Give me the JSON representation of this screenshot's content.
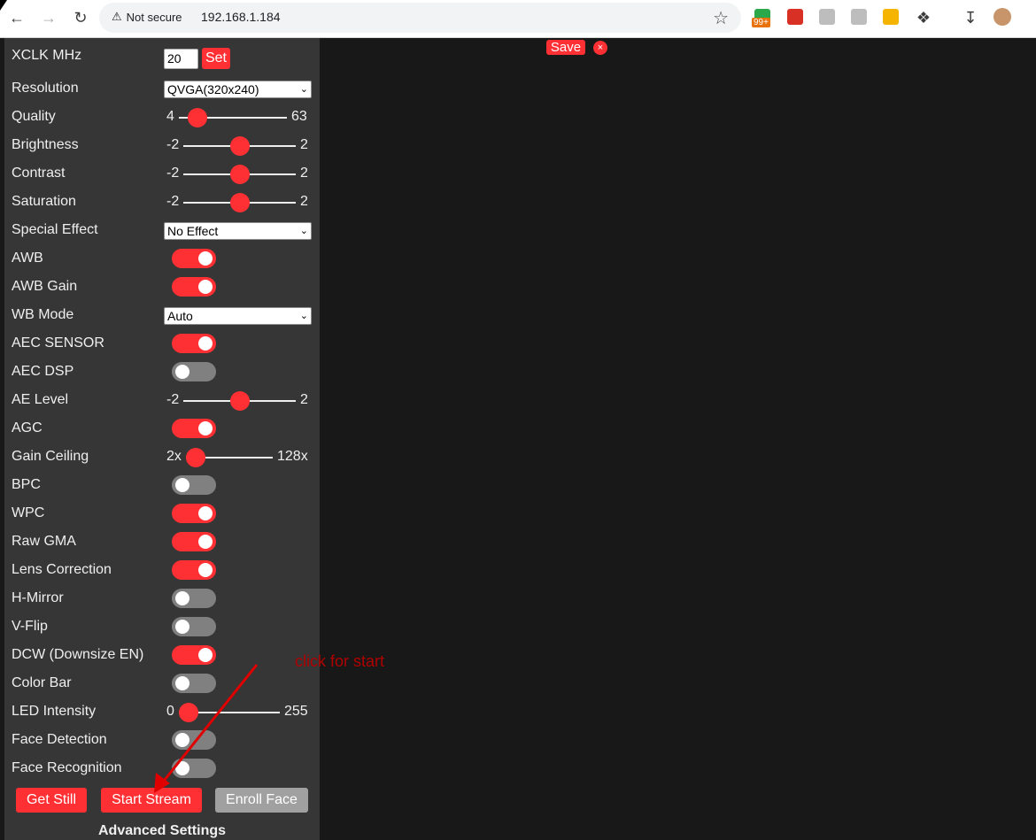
{
  "browser": {
    "security_text": "Not secure",
    "url": "192.168.1.184",
    "badge": "99+"
  },
  "controls": {
    "xclk_label": "XCLK MHz",
    "xclk_value": "20",
    "set_label": "Set",
    "resolution_label": "Resolution",
    "resolution_value": "QVGA(320x240)",
    "quality": {
      "label": "Quality",
      "min": "4",
      "max": "63",
      "value": 10
    },
    "brightness": {
      "label": "Brightness",
      "min": "-2",
      "max": "2",
      "value": 0
    },
    "contrast": {
      "label": "Contrast",
      "min": "-2",
      "max": "2",
      "value": 0
    },
    "saturation": {
      "label": "Saturation",
      "min": "-2",
      "max": "2",
      "value": 0
    },
    "special_effect_label": "Special Effect",
    "special_effect_value": "No Effect",
    "awb": {
      "label": "AWB",
      "on": true
    },
    "awb_gain": {
      "label": "AWB Gain",
      "on": true
    },
    "wb_mode_label": "WB Mode",
    "wb_mode_value": "Auto",
    "aec_sensor": {
      "label": "AEC SENSOR",
      "on": true
    },
    "aec_dsp": {
      "label": "AEC DSP",
      "on": false
    },
    "ae_level": {
      "label": "AE Level",
      "min": "-2",
      "max": "2",
      "value": 0
    },
    "agc": {
      "label": "AGC",
      "on": true
    },
    "gain_ceiling": {
      "label": "Gain Ceiling",
      "min": "2x",
      "max": "128x",
      "value": 0
    },
    "bpc": {
      "label": "BPC",
      "on": false
    },
    "wpc": {
      "label": "WPC",
      "on": true
    },
    "raw_gma": {
      "label": "Raw GMA",
      "on": true
    },
    "lens_correction": {
      "label": "Lens Correction",
      "on": true
    },
    "hmirror": {
      "label": "H-Mirror",
      "on": false
    },
    "vflip": {
      "label": "V-Flip",
      "on": false
    },
    "dcw": {
      "label": "DCW (Downsize EN)",
      "on": true
    },
    "color_bar": {
      "label": "Color Bar",
      "on": false
    },
    "led_intensity": {
      "label": "LED Intensity",
      "min": "0",
      "max": "255",
      "value": 0
    },
    "face_detection": {
      "label": "Face Detection",
      "on": false
    },
    "face_recognition": {
      "label": "Face Recognition",
      "on": false
    }
  },
  "buttons": {
    "get_still": "Get Still",
    "start_stream": "Start Stream",
    "enroll_face": "Enroll Face"
  },
  "advanced_settings": "Advanced Settings",
  "save_label": "Save",
  "close_label": "×",
  "annotation": "click  for start",
  "colors": {
    "accent": "#ff3034",
    "panel": "#363636",
    "background": "#181818"
  }
}
